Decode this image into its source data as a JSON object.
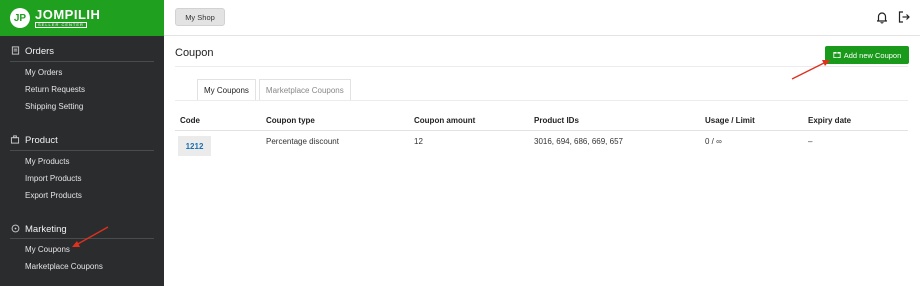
{
  "brand": {
    "mark": "JP",
    "name": "JOMPILIH",
    "sub": "SELLER CENTER"
  },
  "sidebar": {
    "sections": [
      {
        "title": "Orders",
        "icon": "orders-icon",
        "items": [
          "My Orders",
          "Return Requests",
          "Shipping Setting"
        ]
      },
      {
        "title": "Product",
        "icon": "product-icon",
        "items": [
          "My Products",
          "Import Products",
          "Export Products"
        ]
      },
      {
        "title": "Marketing",
        "icon": "marketing-icon",
        "items": [
          "My Coupons",
          "Marketplace Coupons"
        ]
      }
    ]
  },
  "topbar": {
    "shop_label": "My Shop",
    "icons": [
      "bell-icon",
      "logout-icon"
    ]
  },
  "page": {
    "title": "Coupon",
    "add_button": "Add new Coupon",
    "tabs": [
      "My Coupons",
      "Marketplace Coupons"
    ],
    "active_tab": "My Coupons"
  },
  "table": {
    "headers": [
      "Code",
      "Coupon type",
      "Coupon amount",
      "Product IDs",
      "Usage / Limit",
      "Expiry date"
    ],
    "rows": [
      {
        "code": "1212",
        "type": "Percentage discount",
        "amount": "12",
        "product_ids": "3016, 694, 686, 669, 657",
        "usage": "0 / ∞",
        "expiry": "–"
      }
    ]
  },
  "colors": {
    "brand_green": "#1fa01f",
    "button_green": "#1a9a1a",
    "sidebar_bg": "#2b2c2e",
    "annotation_arrow": "#e0301e",
    "code_link": "#1a6fb3"
  }
}
